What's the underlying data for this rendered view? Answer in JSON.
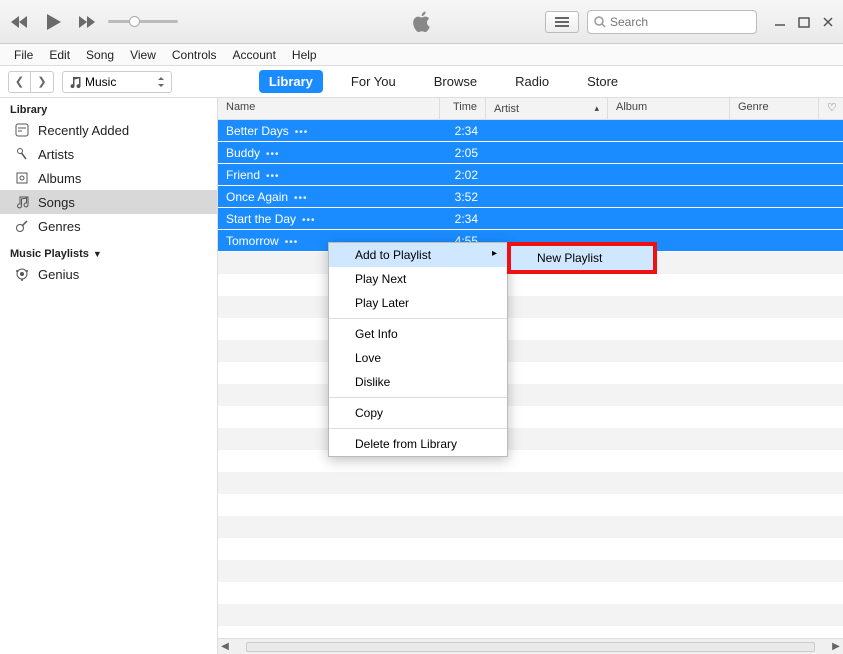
{
  "search": {
    "placeholder": "Search"
  },
  "menu": {
    "items": [
      "File",
      "Edit",
      "Song",
      "View",
      "Controls",
      "Account",
      "Help"
    ]
  },
  "nav": {
    "source_label": "Music",
    "tabs": [
      "Library",
      "For You",
      "Browse",
      "Radio",
      "Store"
    ],
    "active_tab": "Library"
  },
  "sidebar": {
    "section1_title": "Library",
    "items": [
      {
        "label": "Recently Added",
        "icon": "clock"
      },
      {
        "label": "Artists",
        "icon": "mic"
      },
      {
        "label": "Albums",
        "icon": "album"
      },
      {
        "label": "Songs",
        "icon": "note",
        "active": true
      },
      {
        "label": "Genres",
        "icon": "guitar"
      }
    ],
    "section2_title": "Music Playlists",
    "playlists": [
      {
        "label": "Genius",
        "icon": "genius"
      }
    ]
  },
  "columns": {
    "name": "Name",
    "time": "Time",
    "artist": "Artist",
    "album": "Album",
    "genre": "Genre"
  },
  "songs": [
    {
      "name": "Better Days",
      "time": "2:34"
    },
    {
      "name": "Buddy",
      "time": "2:05"
    },
    {
      "name": "Friend",
      "time": "2:02"
    },
    {
      "name": "Once Again",
      "time": "3:52"
    },
    {
      "name": "Start the Day",
      "time": "2:34"
    },
    {
      "name": "Tomorrow",
      "time": "4:55"
    }
  ],
  "context_menu": {
    "items": [
      {
        "label": "Add to Playlist",
        "submenu": true,
        "highlight": true
      },
      {
        "label": "Play Next"
      },
      {
        "label": "Play Later"
      },
      {
        "sep": true
      },
      {
        "label": "Get Info"
      },
      {
        "label": "Love"
      },
      {
        "label": "Dislike"
      },
      {
        "sep": true
      },
      {
        "label": "Copy"
      },
      {
        "sep": true
      },
      {
        "label": "Delete from Library"
      }
    ]
  },
  "submenu": {
    "items": [
      "New Playlist"
    ]
  },
  "colors": {
    "accent": "#1a8cff",
    "highlight_border": "#e11"
  }
}
